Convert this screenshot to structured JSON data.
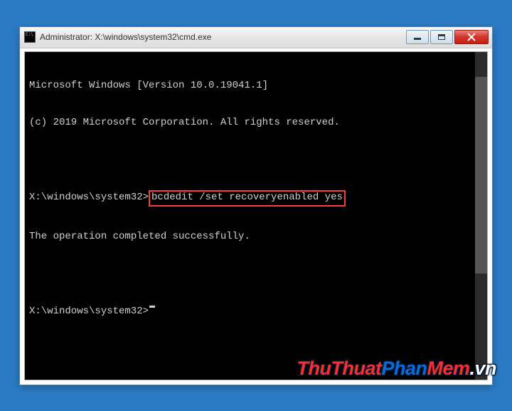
{
  "titlebar": {
    "title": "Administrator: X:\\windows\\system32\\cmd.exe"
  },
  "console": {
    "line1": "Microsoft Windows [Version 10.0.19041.1]",
    "line2": "(c) 2019 Microsoft Corporation. All rights reserved.",
    "blank": "",
    "prompt1_prefix": "X:\\windows\\system32>",
    "prompt1_command": "bcdedit /set recoveryenabled yes",
    "result1": "The operation completed successfully.",
    "prompt2_prefix": "X:\\windows\\system32>"
  },
  "controls": {
    "minimize": "minimize",
    "maximize": "maximize",
    "close": "close"
  },
  "watermark": {
    "part1": "ThuThuat",
    "part2": "Phan",
    "part3": "Mem",
    "suffix": ".vn"
  }
}
